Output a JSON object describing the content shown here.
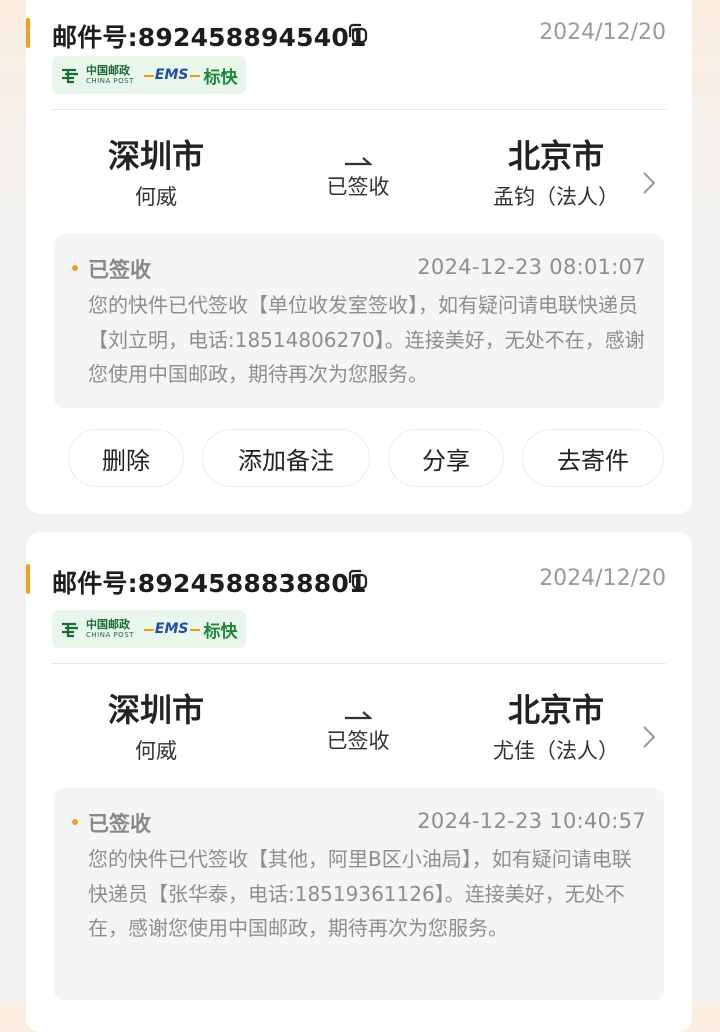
{
  "shipments": [
    {
      "tracking_label": "邮件号:8924588945401",
      "date": "2024/12/20",
      "carrier": {
        "cn": "中国邮政",
        "en": "CHINA POST",
        "ems": "EMS",
        "service": "标快"
      },
      "from": {
        "city": "深圳市",
        "person": "何威"
      },
      "status": "已签收",
      "to": {
        "city": "北京市",
        "person": "孟钧（法人）"
      },
      "latest": {
        "status": "已签收",
        "time": "2024-12-23 08:01:07",
        "detail": "您的快件已代签收【单位收发室签收】，如有疑问请电联快递员【刘立明，电话:18514806270】。连接美好，无处不在，感谢您使用中国邮政，期待再次为您服务。"
      },
      "actions": [
        "删除",
        "添加备注",
        "分享",
        "去寄件"
      ]
    },
    {
      "tracking_label": "邮件号:8924588838801",
      "date": "2024/12/20",
      "carrier": {
        "cn": "中国邮政",
        "en": "CHINA POST",
        "ems": "EMS",
        "service": "标快"
      },
      "from": {
        "city": "深圳市",
        "person": "何威"
      },
      "status": "已签收",
      "to": {
        "city": "北京市",
        "person": "尤佳（法人）"
      },
      "latest": {
        "status": "已签收",
        "time": "2024-12-23 10:40:57",
        "detail": "您的快件已代签收【其他，阿里B区小油局】，如有疑问请电联快递员【张华泰，电话:18519361126】。连接美好，无处不在，感谢您使用中国邮政，期待再次为您服务。"
      }
    }
  ],
  "colors": {
    "accent": "#f0a020",
    "post_green": "#1b6b36",
    "ems_blue": "#1e4fa3"
  }
}
